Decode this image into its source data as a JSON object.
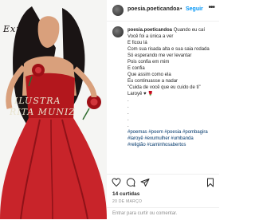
{
  "header": {
    "username": "poesia.poeticandoa",
    "separator": "•",
    "follow_label": "Seguir",
    "more_label": "•••"
  },
  "caption": {
    "username": "poesia.poeticandoa",
    "lines": [
      "Quando eu caí",
      "Você foi a única a ver",
      "E ficou lá",
      "Com sua risada alta e sua saia rodada",
      "Só esperando me ver levantar",
      "Pois confia em mim",
      "E confia",
      "Que assim como ela",
      "Eu continuasse a nadar",
      "\"Cuida de você que eu cuido de ti\"",
      "Laroyê ♥ 🌹"
    ],
    "dots": [
      ".",
      ".",
      ".",
      ".",
      "."
    ],
    "hashtags": [
      "#poemas #poem #poesia #pombagira",
      "#laroyê #exumulher #umbanda",
      "#religião #caminhosabertos"
    ]
  },
  "artwork": {
    "signature": "ILUSTRA",
    "signature2": "RITA MUNIZ",
    "script_word": "Exú"
  },
  "stats": {
    "likes": "14 curtidas",
    "date": "20 DE MARÇO"
  },
  "comment": {
    "placeholder": "Entrar para curtir ou comentar."
  },
  "colors": {
    "link": "#0095f6",
    "dress": "#c8242a",
    "hashtag": "#00376b"
  },
  "icons": [
    "heart-icon",
    "comment-icon",
    "share-icon",
    "bookmark-icon",
    "more-icon"
  ]
}
